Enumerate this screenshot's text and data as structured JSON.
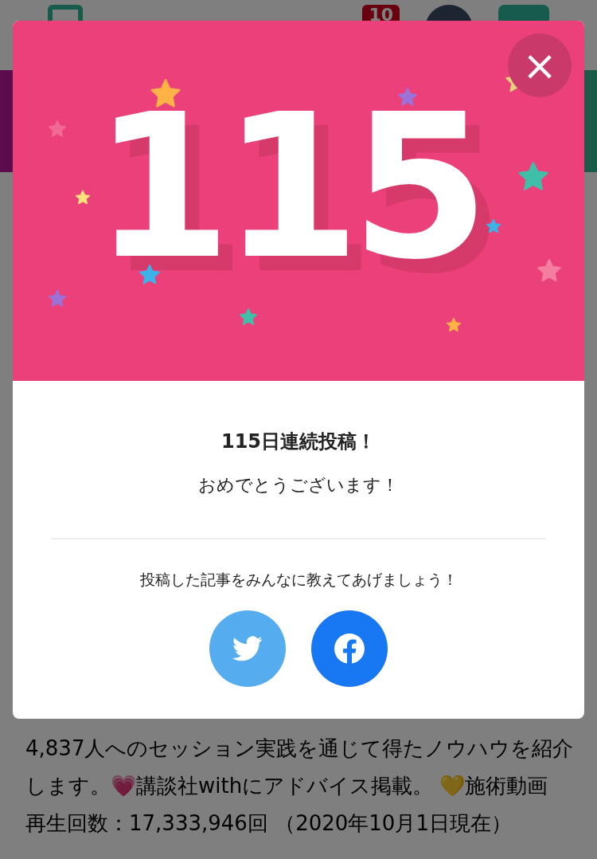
{
  "header": {
    "badge": "10"
  },
  "background_text": [
    "4,837人へのセッション実践を通じて得たノウハウを紹介",
    "します。💗講談社withにアドバイス掲載。 💛施術動画",
    "再生回数：17,333,946回 （2020年10月1日現在）"
  ],
  "modal": {
    "count": "115",
    "close": "×",
    "title": "115日連続投稿！",
    "subtitle": "おめでとうございます！",
    "share_prompt": "投稿した記事をみんなに教えてあげましょう！",
    "share_buttons": [
      {
        "kind": "twitter"
      },
      {
        "kind": "facebook"
      }
    ]
  }
}
